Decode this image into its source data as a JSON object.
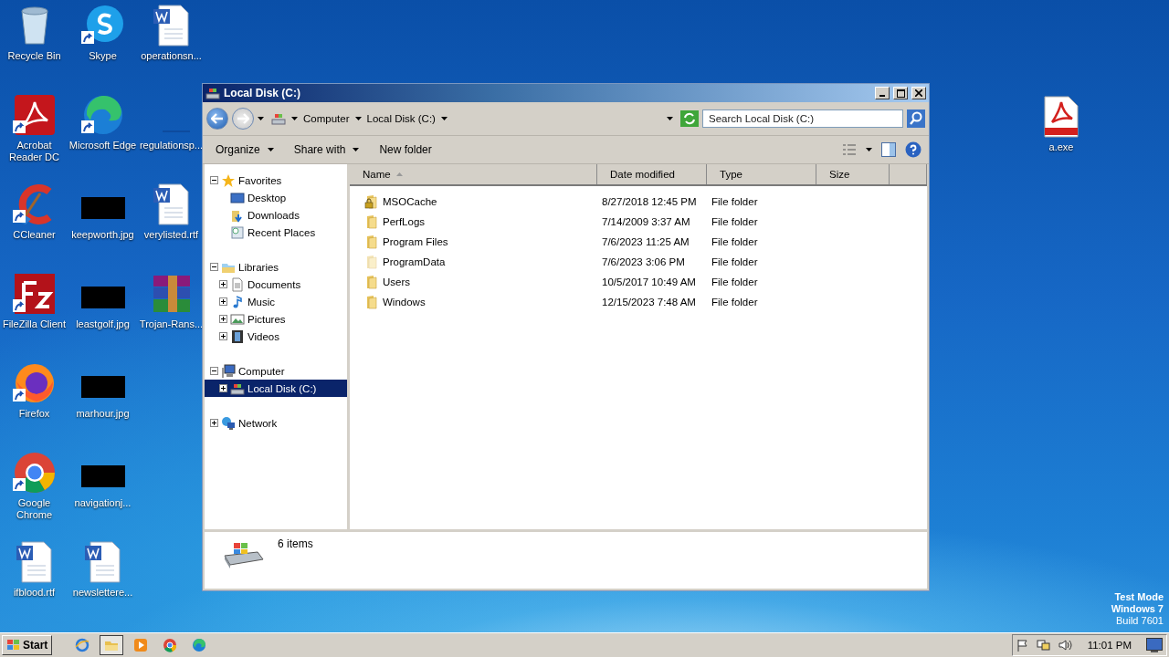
{
  "desktop_icons": [
    {
      "label": "Recycle Bin",
      "kind": "recycle",
      "shortcut": false
    },
    {
      "label": "Acrobat Reader DC",
      "kind": "acrobat",
      "shortcut": true
    },
    {
      "label": "CCleaner",
      "kind": "ccleaner",
      "shortcut": true
    },
    {
      "label": "FileZilla Client",
      "kind": "filezilla",
      "shortcut": true
    },
    {
      "label": "Firefox",
      "kind": "firefox",
      "shortcut": true
    },
    {
      "label": "Google Chrome",
      "kind": "chrome",
      "shortcut": true
    },
    {
      "label": "ifblood.rtf",
      "kind": "word",
      "shortcut": false
    },
    {
      "label": "Skype",
      "kind": "skype",
      "shortcut": true
    },
    {
      "label": "Microsoft Edge",
      "kind": "edge",
      "shortcut": true
    },
    {
      "label": "keepworth.jpg",
      "kind": "image",
      "shortcut": false
    },
    {
      "label": "leastgolf.jpg",
      "kind": "image",
      "shortcut": false
    },
    {
      "label": "marhour.jpg",
      "kind": "image",
      "shortcut": false
    },
    {
      "label": "navigationj...",
      "kind": "image",
      "shortcut": false
    },
    {
      "label": "newslettere...",
      "kind": "word",
      "shortcut": false
    },
    {
      "label": "operationsn...",
      "kind": "word",
      "shortcut": false
    },
    {
      "label": "regulationsp...",
      "kind": "blank",
      "shortcut": false
    },
    {
      "label": "verylisted.rtf",
      "kind": "word",
      "shortcut": false
    },
    {
      "label": "Trojan-Rans...",
      "kind": "winrar",
      "shortcut": false
    }
  ],
  "right_icon": {
    "label": "a.exe",
    "kind": "pdf"
  },
  "window": {
    "title": "Local Disk (C:)",
    "breadcrumb": [
      "Computer",
      "Local Disk (C:)"
    ],
    "search": {
      "placeholder": "Search Local Disk (C:)"
    },
    "commands": [
      {
        "label": "Organize",
        "dropdown": true
      },
      {
        "label": "Share with",
        "dropdown": true
      },
      {
        "label": "New folder",
        "dropdown": false
      }
    ],
    "tree": [
      {
        "label": "Favorites",
        "expanded": true,
        "selected": false,
        "children": [
          {
            "label": "Desktop",
            "selected": false
          },
          {
            "label": "Downloads",
            "selected": false
          },
          {
            "label": "Recent Places",
            "selected": false
          }
        ]
      },
      {
        "label": "Libraries",
        "expanded": true,
        "selected": false,
        "children": [
          {
            "label": "Documents",
            "expanded": false,
            "selected": false
          },
          {
            "label": "Music",
            "expanded": false,
            "selected": false
          },
          {
            "label": "Pictures",
            "expanded": false,
            "selected": false
          },
          {
            "label": "Videos",
            "expanded": false,
            "selected": false
          }
        ]
      },
      {
        "label": "Computer",
        "expanded": true,
        "selected": false,
        "children": [
          {
            "label": "Local Disk (C:)",
            "expanded": false,
            "selected": true
          }
        ]
      },
      {
        "label": "Network",
        "expanded": false,
        "selected": false
      }
    ],
    "columns": [
      {
        "label": "Name",
        "sorted": true
      },
      {
        "label": "Date modified",
        "sorted": false
      },
      {
        "label": "Type",
        "sorted": false
      },
      {
        "label": "Size",
        "sorted": false
      }
    ],
    "rows": [
      {
        "name": "MSOCache",
        "date": "8/27/2018 12:45 PM",
        "type": "File folder",
        "locked": true,
        "hidden": false
      },
      {
        "name": "PerfLogs",
        "date": "7/14/2009 3:37 AM",
        "type": "File folder",
        "locked": false,
        "hidden": false
      },
      {
        "name": "Program Files",
        "date": "7/6/2023 11:25 AM",
        "type": "File folder",
        "locked": false,
        "hidden": false
      },
      {
        "name": "ProgramData",
        "date": "7/6/2023 3:06 PM",
        "type": "File folder",
        "locked": false,
        "hidden": true
      },
      {
        "name": "Users",
        "date": "10/5/2017 10:49 AM",
        "type": "File folder",
        "locked": false,
        "hidden": false
      },
      {
        "name": "Windows",
        "date": "12/15/2023 7:48 AM",
        "type": "File folder",
        "locked": false,
        "hidden": false
      }
    ],
    "status": "6 items"
  },
  "os_notice": [
    "Test Mode",
    "Windows 7",
    "Build 7601"
  ],
  "taskbar": {
    "start": "Start",
    "apps": [
      {
        "kind": "ie",
        "selected": false
      },
      {
        "kind": "explorer",
        "selected": true
      },
      {
        "kind": "media",
        "selected": false
      },
      {
        "kind": "chrome",
        "selected": false
      },
      {
        "kind": "edge",
        "selected": false
      }
    ],
    "clock": "11:01 PM"
  }
}
